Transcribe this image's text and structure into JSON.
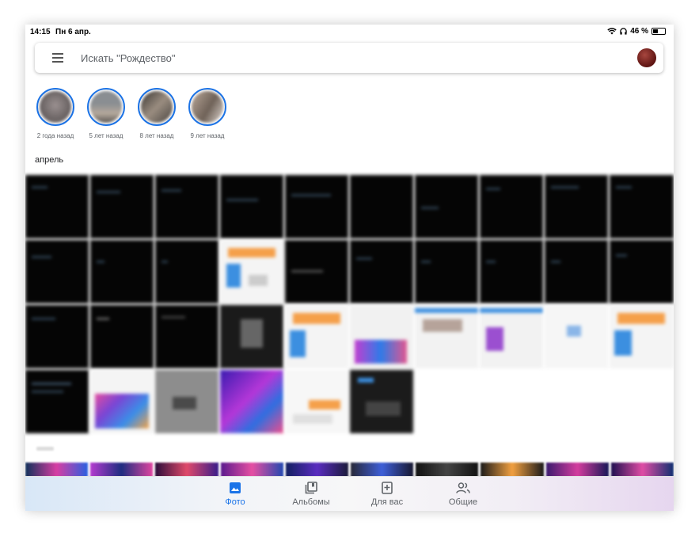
{
  "status_bar": {
    "time": "14:15",
    "date": "Пн 6 апр.",
    "battery": "46 %"
  },
  "search": {
    "placeholder": "Искать \"Рождество\""
  },
  "memories": [
    {
      "label": "2 года назад"
    },
    {
      "label": "5 лет назад"
    },
    {
      "label": "8 лет назад"
    },
    {
      "label": "9 лет назад"
    }
  ],
  "month_label": "апрель",
  "bottom_nav": [
    {
      "label": "Фото",
      "icon": "photo-icon",
      "active": true
    },
    {
      "label": "Альбомы",
      "icon": "albums-icon",
      "active": false
    },
    {
      "label": "Для вас",
      "icon": "for-you-icon",
      "active": false
    },
    {
      "label": "Общие",
      "icon": "shared-icon",
      "active": false
    }
  ],
  "colors": {
    "accent": "#1a73e8",
    "text_secondary": "#5f6368"
  }
}
